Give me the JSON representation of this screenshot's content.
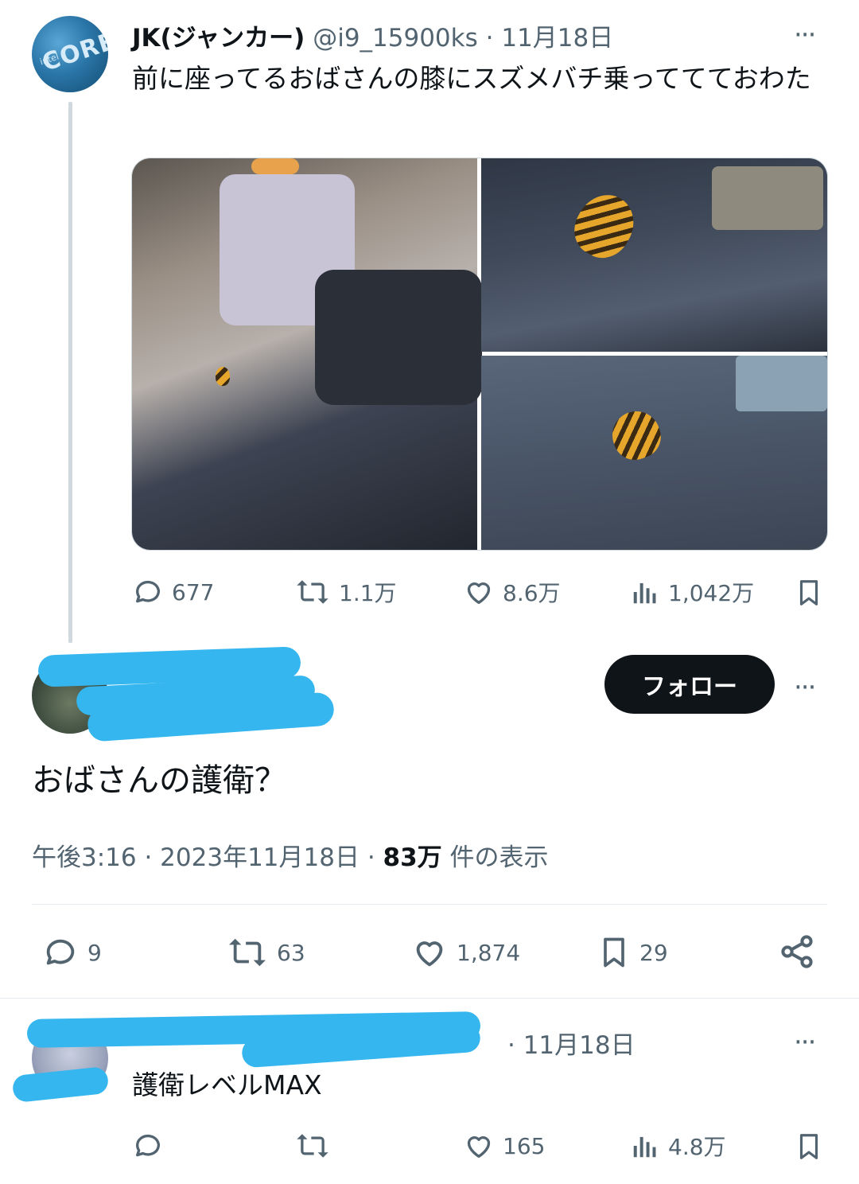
{
  "tweet1": {
    "avatar_text": "CORE",
    "avatar_subtext": "intel",
    "name": "JK(ジャンカー)",
    "handle": "@i9_15900ks",
    "separator": "·",
    "date": "11月18日",
    "text": "前に座ってるおばさんの膝にスズメバチ乗っててておわた",
    "stats": {
      "replies": "677",
      "retweets": "1.1万",
      "likes": "8.6万",
      "views": "1,042万"
    }
  },
  "reply": {
    "follow_label": "フォロー",
    "text": "おばさんの護衛？",
    "meta_time": "午後3:16 · 2023年11月18日 · ",
    "meta_views": "83万",
    "meta_views_suffix": " 件の表示",
    "stats": {
      "replies": "9",
      "retweets": "63",
      "likes": "1,874",
      "bookmarks": "29"
    }
  },
  "tweet3": {
    "date": "· 11月18日",
    "text": "護衛レベルMAX",
    "stats": {
      "likes": "165",
      "views": "4.8万"
    }
  },
  "more_label": "···"
}
